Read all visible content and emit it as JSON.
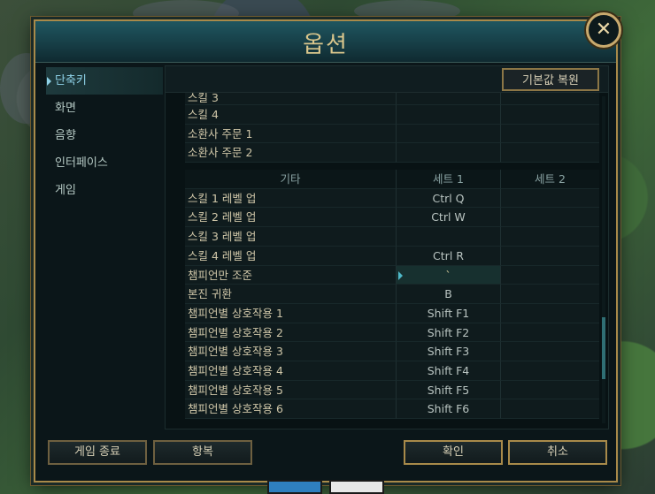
{
  "dialog": {
    "title": "옵션",
    "close_label": "✕"
  },
  "sidebar": {
    "items": [
      {
        "label": "단축키",
        "active": true
      },
      {
        "label": "화면"
      },
      {
        "label": "음향"
      },
      {
        "label": "인터페이스"
      },
      {
        "label": "게임"
      }
    ]
  },
  "toolbar": {
    "reset_label": "기본값 복원"
  },
  "keybinds": {
    "top_rows": [
      {
        "action": "스킬 3",
        "set1": "",
        "set2": ""
      },
      {
        "action": "스킬 4",
        "set1": "",
        "set2": ""
      },
      {
        "action": "소환사 주문 1",
        "set1": "",
        "set2": ""
      },
      {
        "action": "소환사 주문 2",
        "set1": "",
        "set2": ""
      }
    ],
    "headers": {
      "action": "기타",
      "set1": "세트 1",
      "set2": "세트 2"
    },
    "rows": [
      {
        "action": "스킬 1 레벨 업",
        "set1": "Ctrl Q",
        "set2": ""
      },
      {
        "action": "스킬 2 레벨 업",
        "set1": "Ctrl W",
        "set2": ""
      },
      {
        "action": "스킬 3 레벨 업",
        "set1": "",
        "set2": ""
      },
      {
        "action": "스킬 4 레벨 업",
        "set1": "Ctrl R",
        "set2": ""
      },
      {
        "action": "챔피언만 조준",
        "set1": "`",
        "set2": "",
        "focused": true
      },
      {
        "action": "본진 귀환",
        "set1": "B",
        "set2": ""
      },
      {
        "action": "챔피언별 상호작용 1",
        "set1": "Shift F1",
        "set2": ""
      },
      {
        "action": "챔피언별 상호작용 2",
        "set1": "Shift F2",
        "set2": ""
      },
      {
        "action": "챔피언별 상호작용 3",
        "set1": "Shift F3",
        "set2": ""
      },
      {
        "action": "챔피언별 상호작용 4",
        "set1": "Shift F4",
        "set2": ""
      },
      {
        "action": "챔피언별 상호작용 5",
        "set1": "Shift F5",
        "set2": ""
      },
      {
        "action": "챔피언별 상호작용 6",
        "set1": "Shift F6",
        "set2": ""
      }
    ]
  },
  "buttons": {
    "quit": "게임 종료",
    "surrender": "항복",
    "ok": "확인",
    "cancel": "취소"
  },
  "colors": {
    "accent_gold": "#c8aa6e",
    "accent_cyan": "#8fd2e8",
    "panel_bg": "#0b1619"
  }
}
